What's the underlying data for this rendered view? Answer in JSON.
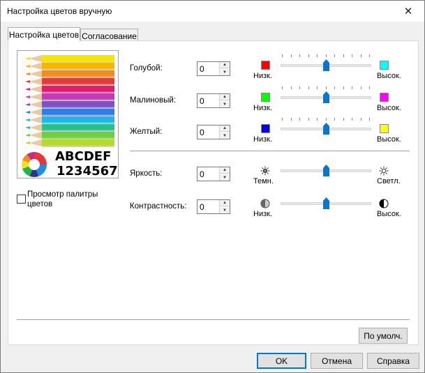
{
  "window": {
    "title": "Настройка цветов вручную"
  },
  "tabs": [
    {
      "label": "Настройка цветов",
      "active": true
    },
    {
      "label": "Согласование",
      "active": false
    }
  ],
  "preview": {
    "text_line1": "ABCDEF",
    "text_line2": "1234567",
    "checkbox_label": "Просмотр палитры цветов",
    "checked": false
  },
  "pencil_colors": [
    "#f5e600",
    "#f7b500",
    "#f28c1e",
    "#e23b3b",
    "#e31b6f",
    "#c23bb5",
    "#7b52c7",
    "#2f7ee6",
    "#1cb8e6",
    "#26c28a",
    "#6fcf3a",
    "#b5db2a"
  ],
  "color_rows": [
    {
      "label": "Голубой:",
      "value": "0",
      "low_label": "Низк.",
      "high_label": "Высок.",
      "low_color": "#ff0000",
      "high_color": "#00ffff",
      "level": 0.5
    },
    {
      "label": "Малиновый:",
      "value": "0",
      "low_label": "Низк.",
      "high_label": "Высок.",
      "low_color": "#00ff00",
      "high_color": "#ff00ff",
      "level": 0.5
    },
    {
      "label": "Желтый:",
      "value": "0",
      "low_label": "Низк.",
      "high_label": "Высок.",
      "low_color": "#0000ff",
      "high_color": "#ffff00",
      "level": 0.5
    }
  ],
  "tone_rows": [
    {
      "label": "Яркость:",
      "value": "0",
      "low_label": "Темн.",
      "high_label": "Светл.",
      "low_icon": "sun-dim-icon",
      "high_icon": "sun-bright-icon",
      "level": 0.5
    },
    {
      "label": "Контрастность:",
      "value": "0",
      "low_label": "Низк.",
      "high_label": "Высок.",
      "low_icon": "contrast-low-icon",
      "high_icon": "contrast-high-icon",
      "level": 0.5
    }
  ],
  "buttons": {
    "default": "По умолч.",
    "ok": "OK",
    "cancel": "Отмена",
    "help": "Справка"
  }
}
